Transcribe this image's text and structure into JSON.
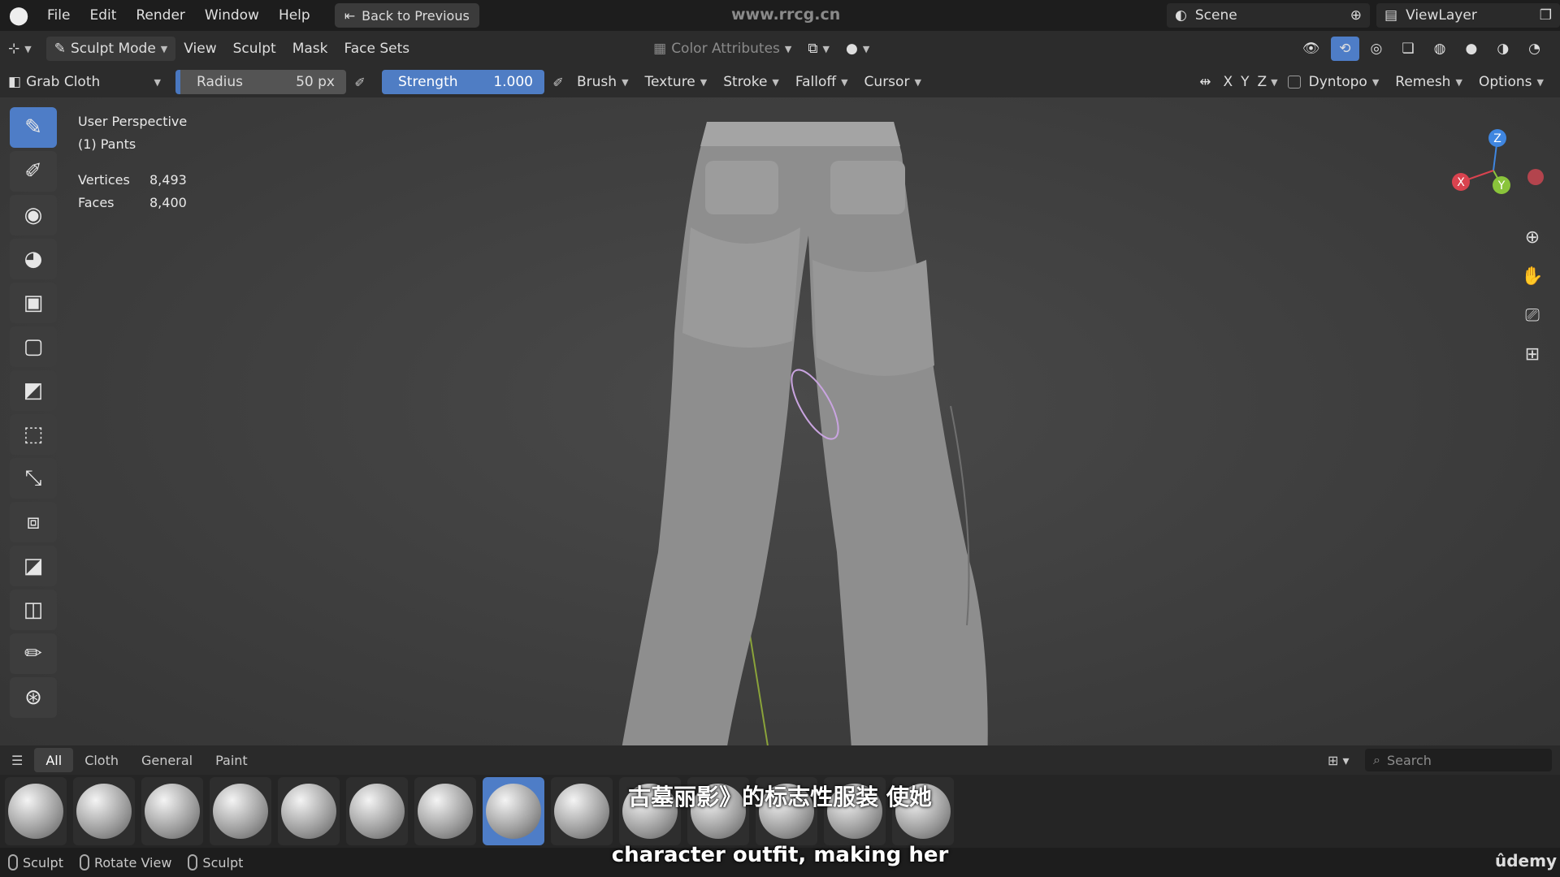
{
  "menu": {
    "items": [
      "File",
      "Edit",
      "Render",
      "Window",
      "Help"
    ],
    "back_label": "Back to Previous"
  },
  "watermark": "www.rrcg.cn",
  "scene": {
    "name": "Scene",
    "view_layer": "ViewLayer"
  },
  "header": {
    "mode": "Sculpt Mode",
    "menus": [
      "View",
      "Sculpt",
      "Mask",
      "Face Sets"
    ],
    "color_attributes": "Color Attributes"
  },
  "tool_settings": {
    "brush_name": "Grab Cloth",
    "radius_label": "Radius",
    "radius_value": "50 px",
    "strength_label": "Strength",
    "strength_value": "1.000",
    "menus": [
      "Brush",
      "Texture",
      "Stroke",
      "Falloff",
      "Cursor"
    ],
    "axes": [
      "X",
      "Y",
      "Z"
    ],
    "right_menus": [
      "Dyntopo",
      "Remesh",
      "Options"
    ]
  },
  "viewport": {
    "perspective": "User Perspective",
    "object": "(1) Pants",
    "stats": [
      {
        "label": "Vertices",
        "value": "8,493"
      },
      {
        "label": "Faces",
        "value": "8,400"
      }
    ],
    "gizmo": {
      "z": "Z",
      "y": "Y",
      "x": "X"
    }
  },
  "brush_shelf": {
    "tabs": [
      "All",
      "Cloth",
      "General",
      "Paint"
    ],
    "search_placeholder": "Search"
  },
  "status_bar": [
    "Sculpt",
    "Rotate View",
    "Sculpt"
  ],
  "subtitles": {
    "line1": "古墓丽影》的标志性服装 使她",
    "line2": "character outfit, making her"
  },
  "brand": "ûdemy",
  "colors": {
    "accent": "#4e7dc7",
    "x_axis": "#d9434f",
    "y_axis": "#8ac43b",
    "z_axis": "#3f86e0"
  }
}
